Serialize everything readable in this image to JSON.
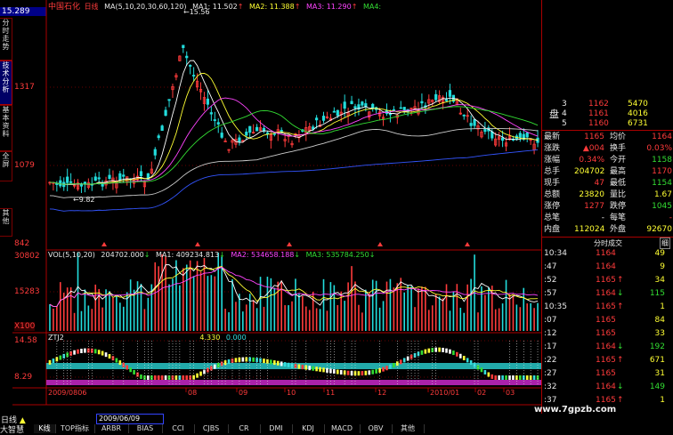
{
  "top_left_badge": "15.289",
  "stock_name": "中国石化",
  "period_label": "日线",
  "ma_header": {
    "label": "MA(5,10,20,30,60,120)",
    "ma1": "MA1: 11.502",
    "ma2": "MA2: 11.388",
    "ma3": "MA3: 11.290",
    "ma4": "MA4:",
    "peak_marker": "15.56"
  },
  "price_axis": [
    "1317",
    "1079",
    "842"
  ],
  "low_marker": "9.82",
  "vol_header": {
    "label": "VOL(5,10,20)",
    "vol": "204702.000",
    "ma1": "MA1: 409234.813",
    "ma2": "MA2: 534658.188",
    "ma3": "MA3: 535784.250"
  },
  "vol_axis": [
    "30802",
    "15283",
    "X100"
  ],
  "ind_header": {
    "label": "ZTJ2",
    "v1": "4.330",
    "v2": "0.000"
  },
  "ind_axis": [
    "14.58",
    "8.29"
  ],
  "date_axis": [
    "2009/0806",
    "08",
    "09",
    "10",
    "11",
    "12",
    "2010/01",
    "02",
    "03"
  ],
  "left_tabs": [
    "分时走势",
    "技术分析",
    "基本资料",
    "全屏",
    "其他"
  ],
  "bottom": {
    "period": "日线",
    "date_input": "2009/06/09",
    "brand": "大智慧",
    "tabs": [
      "K线",
      "TOP指标",
      "ARBR",
      "BIAS",
      "CCI",
      "CJBS",
      "CR",
      "DMI",
      "KDJ",
      "MACD",
      "OBV",
      "其他"
    ]
  },
  "order_book": [
    {
      "label": "3",
      "price": "1162",
      "vol": "5470"
    },
    {
      "label": "4",
      "price": "1161",
      "vol": "4016"
    },
    {
      "label": "5",
      "price": "1160",
      "vol": "6731"
    }
  ],
  "order_book_side": "盘",
  "quote": [
    {
      "k1": "最新",
      "v1": "1165",
      "k2": "均价",
      "v2": "1164"
    },
    {
      "k1": "涨跌",
      "v1": "▲004",
      "k2": "换手",
      "v2": "0.03%"
    },
    {
      "k1": "涨幅",
      "v1": "0.34%",
      "k2": "今开",
      "v2": "1158"
    },
    {
      "k1": "总手",
      "v1": "204702",
      "k2": "最高",
      "v2": "1170"
    },
    {
      "k1": "现手",
      "v1": "47",
      "k2": "最低",
      "v2": "1154"
    },
    {
      "k1": "总额",
      "v1": "23820",
      "k2": "量比",
      "v2": "1.67"
    },
    {
      "k1": "涨停",
      "v1": "1277",
      "k2": "跌停",
      "v2": "1045"
    },
    {
      "k1": "总笔",
      "v1": "-",
      "k2": "每笔",
      "v2": "-"
    },
    {
      "k1": "内盘",
      "v1": "112024",
      "k2": "外盘",
      "v2": "92670"
    }
  ],
  "trades_title": "分时成交",
  "trades_tab": "细",
  "trades": [
    {
      "t": "10:34",
      "p": "1164",
      "a": "",
      "v": "49"
    },
    {
      "t": ":47",
      "p": "1164",
      "a": "",
      "v": "9"
    },
    {
      "t": ":52",
      "p": "1165",
      "a": "↑",
      "v": "34"
    },
    {
      "t": ":57",
      "p": "1164",
      "a": "↓",
      "v": "115"
    },
    {
      "t": "10:35",
      "p": "1165",
      "a": "↑",
      "v": "1"
    },
    {
      "t": ":07",
      "p": "1165",
      "a": "",
      "v": "84"
    },
    {
      "t": ":12",
      "p": "1165",
      "a": "",
      "v": "33"
    },
    {
      "t": ":17",
      "p": "1164",
      "a": "↓",
      "v": "192"
    },
    {
      "t": ":22",
      "p": "1165",
      "a": "↑",
      "v": "671"
    },
    {
      "t": ":27",
      "p": "1165",
      "a": "",
      "v": "31"
    },
    {
      "t": ":32",
      "p": "1164",
      "a": "↓",
      "v": "149"
    },
    {
      "t": ":37",
      "p": "1165",
      "a": "↑",
      "v": "1"
    }
  ],
  "watermark": "www.7gpzb.com"
}
